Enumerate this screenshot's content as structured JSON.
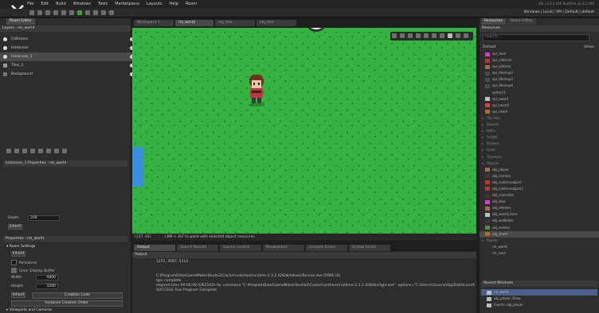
{
  "menu": {
    "items": [
      "File",
      "Edit",
      "Build",
      "Windows",
      "Tools",
      "Marketplace",
      "Layouts",
      "Help",
      "Room"
    ],
    "version": "IDE v2.3.2.556 Runtime v2.3.2.426",
    "targets": "Windows | Local | VM | Default | default"
  },
  "room_editor": {
    "tab_label": "Room Editor",
    "layers_header": "Layers - rm_world",
    "layers": [
      {
        "name": "Collisions"
      },
      {
        "name": "Instances"
      },
      {
        "name": "Instances_1"
      },
      {
        "name": "Tiles_1"
      },
      {
        "name": "Background"
      }
    ],
    "instances_header": "Instances_1 Properties - rm_world",
    "depth_label": "Depth",
    "depth_value": "200",
    "inherit_label": "Inherit",
    "properties_header": "Properties - rm_world",
    "room_settings_label": "Room Settings",
    "persistent_label": "Persistent",
    "clear_display_label": "Clear Display Buffer",
    "width_label": "Width",
    "width_value": "4800",
    "height_label": "Height",
    "height_value": "3200",
    "creation_code_label": "Creation Code",
    "creation_order_label": "Instance Creation Order",
    "viewports_label": "Viewports and Cameras"
  },
  "workspace": {
    "tabs": [
      {
        "label": "Workspace 1"
      },
      {
        "label": "rm_world"
      },
      {
        "label": "obj_test"
      },
      {
        "label": "obj_title"
      }
    ],
    "status_coords": "(127, 81)",
    "status_hint": "LMB + ALT to paint with selected object resources"
  },
  "output": {
    "tabs": [
      {
        "label": "Output"
      },
      {
        "label": "Search Results"
      },
      {
        "label": "Source Control"
      },
      {
        "label": "Breakpoints"
      },
      {
        "label": "Compile Errors"
      },
      {
        "label": "Syntax Errors"
      }
    ],
    "header": "Output",
    "lines": [
      "1372, 4587, 2313",
      "",
      "",
      "C:\\ProgramData\\GameMakerStudio2\\Cache\\runtimes\\runtime-2.3.2.426/windows/Runner.exe DONE (0)",
      "Igor complete.",
      "elapsed time 00:00:09.4361542s for command \"C:\\ProgramData\\GameMakerStudio2\\Cache\\runtimes\\runtime-2.3.2.426/bin/Igor.exe\" -options=\"C:\\Users\\Usuario\\AppData\\Local\\GameMa",
      "SUCCESS: Run Program Complete"
    ]
  },
  "resources": {
    "tabs": [
      {
        "label": "Resources"
      },
      {
        "label": "Room Editor"
      }
    ],
    "header": "Resources",
    "search_placeholder": "Search...",
    "views_label": "Views",
    "default_group": "Default",
    "items": [
      {
        "name": "spr_door",
        "color": "#d93bd0",
        "kind": "item"
      },
      {
        "name": "spr_collision",
        "color": "#c2352b",
        "kind": "item"
      },
      {
        "name": "spr_oldman",
        "color": "#a36b4b",
        "kind": "item"
      },
      {
        "name": "spr_tilemap2",
        "color": "#4a4a4a",
        "kind": "item"
      },
      {
        "name": "spr_tilemap3",
        "color": "#4a4a4a",
        "kind": "item"
      },
      {
        "name": "spr_tilemap4",
        "color": "#4a4a4a",
        "kind": "item"
      },
      {
        "name": "sprite13",
        "color": "#2d2d2d",
        "kind": "item"
      },
      {
        "name": "spr_sword",
        "color": "#bfbfbf",
        "kind": "item"
      },
      {
        "name": "spr_heart1",
        "color": "#d0443d",
        "kind": "item"
      },
      {
        "name": "spr_chest",
        "color": "#b36a2a",
        "kind": "item"
      },
      {
        "name": "Tile Sets",
        "kind": "group"
      },
      {
        "name": "Sounds",
        "kind": "group"
      },
      {
        "name": "Paths",
        "kind": "group"
      },
      {
        "name": "Scripts",
        "kind": "group"
      },
      {
        "name": "Shaders",
        "kind": "group"
      },
      {
        "name": "Fonts",
        "kind": "group"
      },
      {
        "name": "Timelines",
        "kind": "group"
      },
      {
        "name": "Objects",
        "kind": "open"
      },
      {
        "name": "obj_player",
        "color": "#a36b4b",
        "kind": "item"
      },
      {
        "name": "obj_camera",
        "color": "#3a3a3a",
        "kind": "item"
      },
      {
        "name": "obj_collisionobject",
        "color": "#c2352b",
        "kind": "item"
      },
      {
        "name": "obj_collisionobject1",
        "color": "#c2352b",
        "kind": "item"
      },
      {
        "name": "obj_controller",
        "color": "#3a3a3a",
        "kind": "item"
      },
      {
        "name": "obj_door",
        "color": "#d93bd0",
        "kind": "item"
      },
      {
        "name": "obj_oldman",
        "color": "#a36b4b",
        "kind": "item"
      },
      {
        "name": "obj_sword_item",
        "color": "#bfbfbf",
        "kind": "item"
      },
      {
        "name": "obj_wallblock",
        "color": "#3a3a3a",
        "kind": "item"
      },
      {
        "name": "obj_enemy",
        "color": "#5a8a3a",
        "kind": "item"
      },
      {
        "name": "obj_chest",
        "color": "#b36a2a",
        "kind": "item"
      },
      {
        "name": "Rooms",
        "kind": "open"
      },
      {
        "name": "rm_world",
        "color": "#2d2d2d",
        "kind": "item"
      },
      {
        "name": "rm_cave",
        "color": "#2d2d2d",
        "kind": "item"
      }
    ],
    "recent_header": "Recent Windows",
    "recent": [
      {
        "name": "rm_world"
      },
      {
        "name": "obj_player: Draw"
      },
      {
        "name": "Events: obj_player"
      }
    ]
  }
}
